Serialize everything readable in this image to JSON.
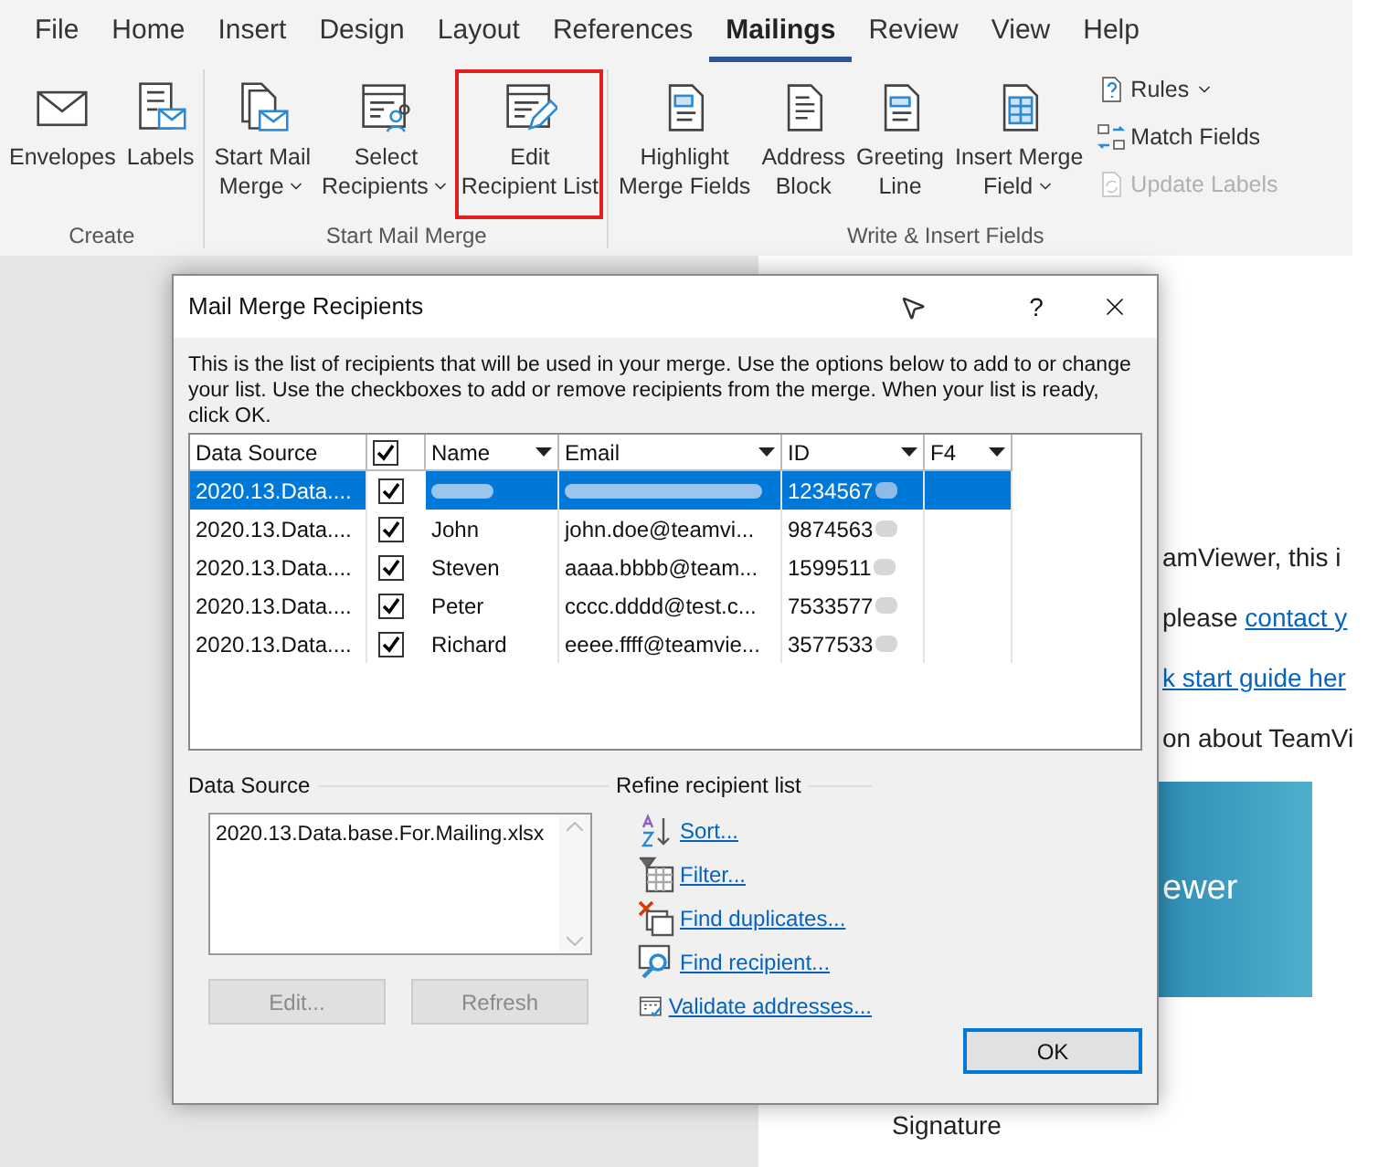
{
  "ribbon": {
    "tabs": [
      {
        "label": "File",
        "selected": false
      },
      {
        "label": "Home",
        "selected": false
      },
      {
        "label": "Insert",
        "selected": false
      },
      {
        "label": "Design",
        "selected": false
      },
      {
        "label": "Layout",
        "selected": false
      },
      {
        "label": "References",
        "selected": false
      },
      {
        "label": "Mailings",
        "selected": true
      },
      {
        "label": "Review",
        "selected": false
      },
      {
        "label": "View",
        "selected": false
      },
      {
        "label": "Help",
        "selected": false
      }
    ],
    "groups": [
      {
        "label": "Create",
        "items": [
          {
            "kind": "large",
            "lines": [
              "Envelopes"
            ],
            "dropdown": false,
            "annotated": false
          },
          {
            "kind": "large",
            "lines": [
              "Labels"
            ],
            "dropdown": false,
            "annotated": false
          }
        ]
      },
      {
        "label": "Start Mail Merge",
        "items": [
          {
            "kind": "large",
            "lines": [
              "Start Mail",
              "Merge"
            ],
            "dropdown": true,
            "annotated": false
          },
          {
            "kind": "large",
            "lines": [
              "Select",
              "Recipients"
            ],
            "dropdown": true,
            "annotated": false
          },
          {
            "kind": "large",
            "lines": [
              "Edit",
              "Recipient List"
            ],
            "dropdown": false,
            "annotated": true
          }
        ]
      },
      {
        "label": "Write & Insert Fields",
        "items": [
          {
            "kind": "large",
            "lines": [
              "Highlight",
              "Merge Fields"
            ],
            "dropdown": false,
            "annotated": false
          },
          {
            "kind": "large",
            "lines": [
              "Address",
              "Block"
            ],
            "dropdown": false,
            "annotated": false
          },
          {
            "kind": "large",
            "lines": [
              "Greeting",
              "Line"
            ],
            "dropdown": false,
            "annotated": false
          },
          {
            "kind": "large",
            "lines": [
              "Insert Merge",
              "Field"
            ],
            "dropdown": true,
            "annotated": false
          },
          {
            "kind": "stack",
            "items": [
              {
                "label": "Rules",
                "dropdown": true,
                "disabled": false
              },
              {
                "label": "Match Fields",
                "dropdown": false,
                "disabled": false
              },
              {
                "label": "Update Labels",
                "dropdown": false,
                "disabled": true
              }
            ]
          }
        ]
      }
    ]
  },
  "document": {
    "lines": [
      {
        "text": "amViewer, this i"
      },
      {
        "text": "please ",
        "link": "contact y"
      },
      {
        "link": "k start guide her"
      },
      {
        "text": "on about TeamVi"
      }
    ],
    "banner": "ewer",
    "signature": "Signature"
  },
  "dialog": {
    "title": "Mail Merge Recipients",
    "help": "?",
    "description": "This is the list of recipients that will be used in your merge.  Use the options below to add to or change your list.  Use the checkboxes to add or remove recipients from the merge.  When your list is ready, click OK.",
    "table": {
      "columns": [
        {
          "kind": "text",
          "label": "Data Source",
          "dropdown": false
        },
        {
          "kind": "checkbox",
          "checked": true
        },
        {
          "kind": "text",
          "label": "Name",
          "dropdown": true
        },
        {
          "kind": "text",
          "label": "Email",
          "dropdown": true
        },
        {
          "kind": "text",
          "label": "ID",
          "dropdown": true
        },
        {
          "kind": "text",
          "label": "F4",
          "dropdown": true
        }
      ],
      "rows": [
        {
          "source": "2020.13.Data....",
          "checked": true,
          "selected": true,
          "redacted": true,
          "id": "1234567"
        },
        {
          "source": "2020.13.Data....",
          "checked": true,
          "selected": false,
          "redacted": false,
          "name": "John",
          "email": "john.doe@teamvi...",
          "id": "9874563"
        },
        {
          "source": "2020.13.Data....",
          "checked": true,
          "selected": false,
          "redacted": false,
          "name": "Steven",
          "email": "aaaa.bbbb@team...",
          "id": "1599511"
        },
        {
          "source": "2020.13.Data....",
          "checked": true,
          "selected": false,
          "redacted": false,
          "name": "Peter",
          "email": "cccc.dddd@test.c...",
          "id": "7533577"
        },
        {
          "source": "2020.13.Data....",
          "checked": true,
          "selected": false,
          "redacted": false,
          "name": "Richard",
          "email": "eeee.ffff@teamvie...",
          "id": "3577533"
        }
      ]
    },
    "data_source": {
      "label": "Data Source",
      "files": [
        "2020.13.Data.base.For.Mailing.xlsx"
      ],
      "buttons": [
        {
          "label": "Edit...",
          "disabled": true
        },
        {
          "label": "Refresh",
          "disabled": true
        }
      ]
    },
    "refine": {
      "label": "Refine recipient list",
      "links": [
        {
          "label": "Sort..."
        },
        {
          "label": "Filter..."
        },
        {
          "label": "Find duplicates..."
        },
        {
          "label": "Find recipient..."
        },
        {
          "label": "Validate addresses..."
        }
      ]
    },
    "ok": "OK"
  }
}
